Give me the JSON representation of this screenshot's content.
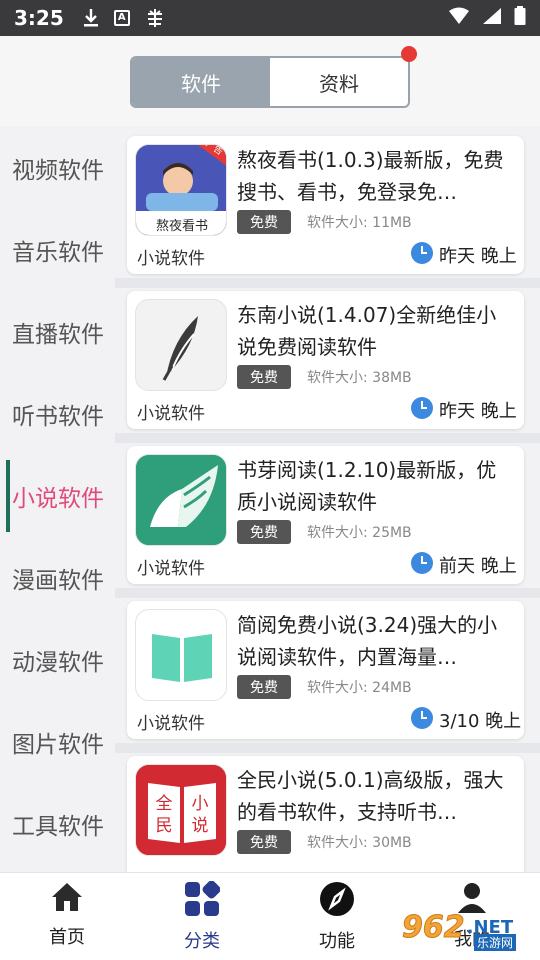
{
  "status_bar": {
    "time": "3:25"
  },
  "header": {
    "tabs": [
      {
        "label": "软件",
        "active": true
      },
      {
        "label": "资料",
        "active": false
      }
    ],
    "accent_dot_color": "#e53935"
  },
  "categories": [
    {
      "label": "视频软件",
      "active": false
    },
    {
      "label": "音乐软件",
      "active": false
    },
    {
      "label": "直播软件",
      "active": false
    },
    {
      "label": "听书软件",
      "active": false
    },
    {
      "label": "小说软件",
      "active": true
    },
    {
      "label": "漫画软件",
      "active": false
    },
    {
      "label": "动漫软件",
      "active": false
    },
    {
      "label": "图片软件",
      "active": false
    },
    {
      "label": "工具软件",
      "active": false
    }
  ],
  "apps": [
    {
      "title": "熬夜看书(1.0.3)最新版，免费搜书、看书，免登录免…",
      "badge": "免费",
      "size": "软件大小: 11MB",
      "category": "小说软件",
      "time": "昨天 晚上",
      "icon": "aoye-book-icon",
      "icon_text": "熬夜看书",
      "corner_tag": "无广告"
    },
    {
      "title": "东南小说(1.4.07)全新绝佳小说免费阅读软件",
      "badge": "免费",
      "size": "软件大小: 38MB",
      "category": "小说软件",
      "time": "昨天 晚上",
      "icon": "feather-icon"
    },
    {
      "title": "书芽阅读(1.2.10)最新版，优质小说阅读软件",
      "badge": "免费",
      "size": "软件大小: 25MB",
      "category": "小说软件",
      "time": "前天 晚上",
      "icon": "leaf-book-icon"
    },
    {
      "title": "简阅免费小说(3.24)强大的小说阅读软件，内置海量…",
      "badge": "免费",
      "size": "软件大小: 24MB",
      "category": "小说软件",
      "time": "3/10 晚上",
      "icon": "open-book-icon"
    },
    {
      "title": "全民小说(5.0.1)高级版，强大的看书软件，支持听书…",
      "badge": "免费",
      "size": "软件大小: 30MB",
      "category": "小说软件",
      "time": "",
      "icon": "quanmin-book-icon",
      "icon_chars": [
        "全",
        "小",
        "民",
        "说"
      ]
    }
  ],
  "bottom_nav": [
    {
      "label": "首页",
      "icon": "home-icon",
      "active": false
    },
    {
      "label": "分类",
      "icon": "category-icon",
      "active": true
    },
    {
      "label": "功能",
      "icon": "compass-icon",
      "active": false
    },
    {
      "label": "我的",
      "icon": "user-icon",
      "active": false
    }
  ],
  "watermark": {
    "number": "962",
    "domain": ".NET",
    "sub": "乐游网"
  },
  "colors": {
    "active_category": "#e04b7a",
    "active_nav": "#2a3a8c",
    "segment_active": "#9aa4ae",
    "clock": "#3c8ae0"
  }
}
